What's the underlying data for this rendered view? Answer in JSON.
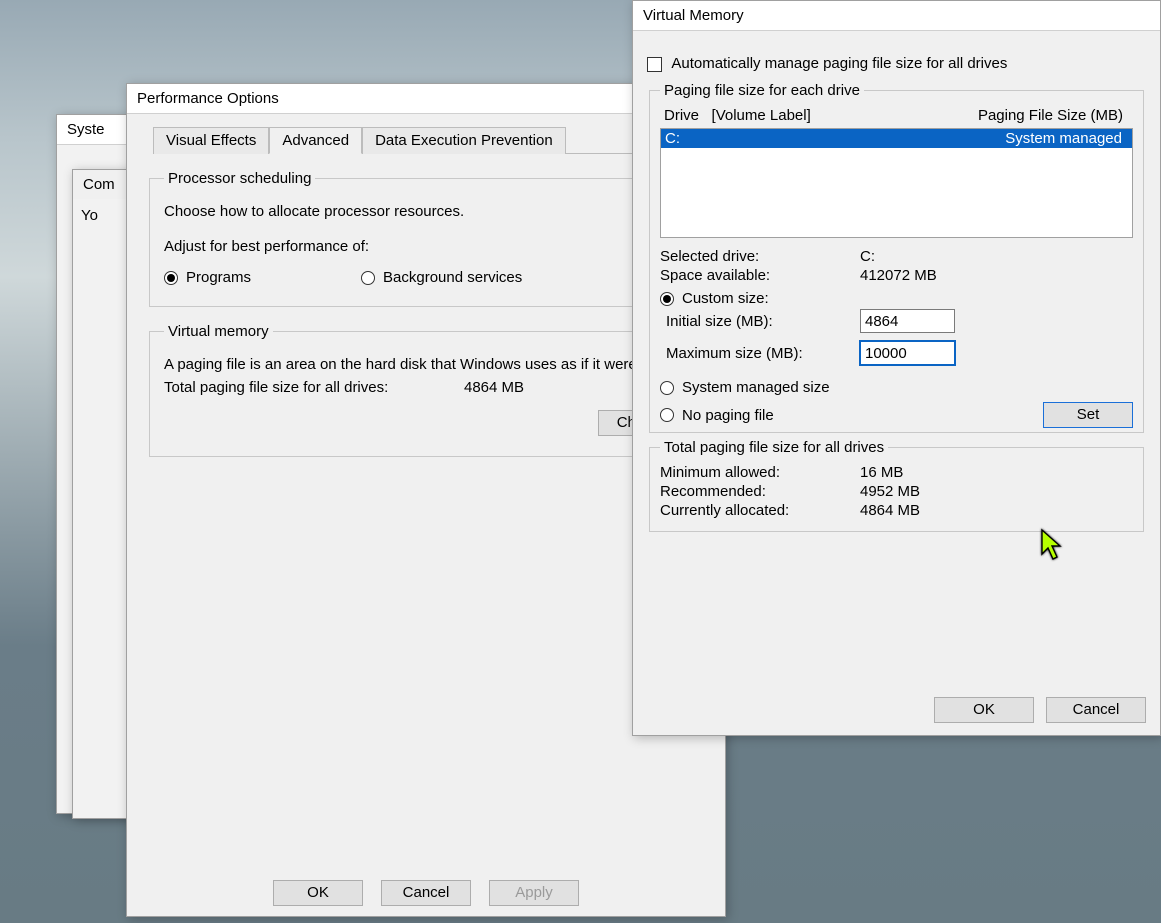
{
  "bg_windows": {
    "system_properties": "Syste",
    "computer_name": "Com",
    "you": "Yo"
  },
  "performance_options": {
    "title": "Performance Options",
    "tabs": {
      "visual_effects": "Visual Effects",
      "advanced": "Advanced",
      "dep": "Data Execution Prevention"
    },
    "processor_scheduling": {
      "legend": "Processor scheduling",
      "intro": "Choose how to allocate processor resources.",
      "adjust": "Adjust for best performance of:",
      "radio_programs": "Programs",
      "radio_background": "Background services"
    },
    "virtual_memory": {
      "legend": "Virtual memory",
      "desc": "A paging file is an area on the hard disk that Windows uses as if it were RAM.",
      "total_label": "Total paging file size for all drives:",
      "total_value": "4864 MB",
      "change_btn": "Change"
    },
    "buttons": {
      "ok": "OK",
      "cancel": "Cancel",
      "apply": "Apply"
    }
  },
  "virtual_memory_dialog": {
    "title": "Virtual Memory",
    "auto_manage": "Automatically manage paging file size for all drives",
    "each_drive_legend": "Paging file size for each drive",
    "header_drive": "Drive",
    "header_volume": "[Volume Label]",
    "header_size": "Paging File Size (MB)",
    "drives": [
      {
        "drive": "C:",
        "size": "System managed"
      }
    ],
    "selected_drive_label": "Selected drive:",
    "selected_drive_value": "C:",
    "space_label": "Space available:",
    "space_value": "412072 MB",
    "radio_custom": "Custom size:",
    "initial_label": "Initial size (MB):",
    "initial_value": "4864",
    "max_label": "Maximum size (MB):",
    "max_value": "10000",
    "radio_system": "System managed size",
    "radio_none": "No paging file",
    "set_btn": "Set",
    "totals_legend": "Total paging file size for all drives",
    "min_label": "Minimum allowed:",
    "min_value": "16 MB",
    "rec_label": "Recommended:",
    "rec_value": "4952 MB",
    "cur_label": "Currently allocated:",
    "cur_value": "4864 MB",
    "ok": "OK",
    "cancel": "Cancel"
  }
}
